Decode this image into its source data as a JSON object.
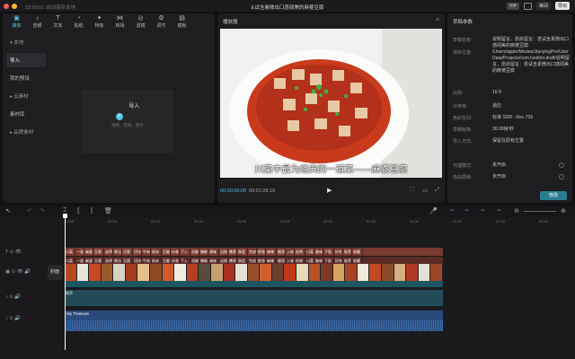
{
  "titlebar": {
    "autosave": "23:59:01 自动保存本地",
    "title": "E试含素微出口感闻美的麻婆豆腐",
    "vip": "VIP",
    "share": "审阅",
    "export": "导出"
  },
  "toolbar": [
    {
      "label": "媒体",
      "icon": "media-icon"
    },
    {
      "label": "音频",
      "icon": "audio-icon"
    },
    {
      "label": "文本",
      "icon": "text-icon"
    },
    {
      "label": "贴纸",
      "icon": "sticker-icon"
    },
    {
      "label": "特效",
      "icon": "effects-icon"
    },
    {
      "label": "转场",
      "icon": "transition-icon"
    },
    {
      "label": "滤镜",
      "icon": "filter-icon"
    },
    {
      "label": "调节",
      "icon": "adjust-icon"
    },
    {
      "label": "模板",
      "icon": "template-icon"
    }
  ],
  "sidebar": {
    "local": "▾ 本地",
    "import": "导入",
    "presets": "我的预设",
    "cloud": "▸ 云素材",
    "library": "素材库",
    "brand": "▸ 品牌素材"
  },
  "import": {
    "label": "导入",
    "hint": "视频、音频、图片"
  },
  "player": {
    "title": "播放器",
    "subtitle": "川菜中最为经典的一道菜——麻婆豆腐",
    "current": "00:00:00:00",
    "duration": "00:01:28:10"
  },
  "props": {
    "title": "草稿参数",
    "rows": [
      {
        "k": "草稿名称:",
        "v": "说明留言，愿启留言：尝试含素微出口感闻美的麻婆豆腐"
      },
      {
        "k": "保存位置:",
        "v": "/Users/apple/Movies/JianyingPro/User Data/Projects/com.lveditor.draft/说明留言，愿启留言：尝试含素微出口感闻美的麻婆豆腐"
      },
      {
        "k": "比例:",
        "v": "16:9"
      },
      {
        "k": "分辨率:",
        "v": "适应"
      },
      {
        "k": "色彩空间:",
        "v": "标准 SDR - Rec.709"
      },
      {
        "k": "草稿帧率:",
        "v": "30.00帧/秒"
      },
      {
        "k": "导入方式:",
        "v": "保留在原有位置"
      },
      {
        "k": "代理模式:",
        "v": "未开启"
      },
      {
        "k": "自由层级:",
        "v": "未开启"
      }
    ],
    "modify": "修改"
  },
  "timeline": {
    "ticks": [
      "00:00",
      "00:15",
      "00:30",
      "00:45",
      "01:00",
      "01:15",
      "01:30",
      "01:45",
      "02:00",
      "02:15",
      "02:30",
      "02:45",
      "03:00"
    ],
    "text_clips": [
      "川菜",
      "一道",
      "麻婆",
      "豆腐",
      "选择",
      "做法",
      "豆腐",
      "切块",
      "牛肉",
      "剁末",
      "豆瓣",
      "炒香",
      "下入",
      "花椒",
      "辣椒",
      "调味",
      "出锅",
      "撒葱",
      "装盘",
      "完成",
      "鲜香",
      "麻辣",
      "嫩滑",
      "入味",
      "经典",
      "川菜",
      "美味",
      "下饭",
      "好吃",
      "推荐",
      "收藏"
    ],
    "cover": "封面",
    "music": "My Treasure",
    "audio_label": "原声"
  },
  "colors": {
    "accent": "#4fc9e2",
    "text_track": "#7a3a30",
    "video_under": "#1d5560",
    "music": "#2a4a7c"
  }
}
